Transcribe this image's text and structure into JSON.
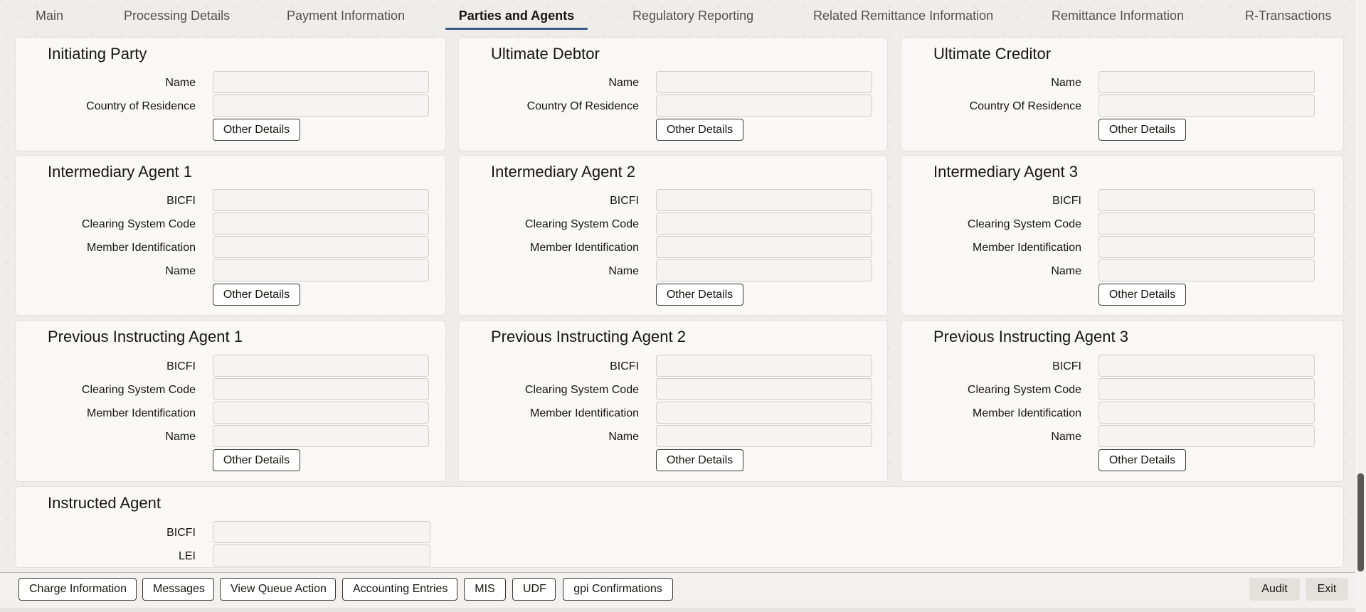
{
  "tabs": [
    {
      "label": "Main"
    },
    {
      "label": "Processing Details"
    },
    {
      "label": "Payment Information"
    },
    {
      "label": "Parties and Agents"
    },
    {
      "label": "Regulatory Reporting"
    },
    {
      "label": "Related Remittance Information"
    },
    {
      "label": "Remittance Information"
    },
    {
      "label": "R-Transactions"
    }
  ],
  "active_tab": "Parties and Agents",
  "accent_color": "#3d5c85",
  "panels": {
    "initiating_party": {
      "title": "Initiating Party",
      "name_label": "Name",
      "country_label": "Country of Residence",
      "other_details": "Other Details"
    },
    "ultimate_debtor": {
      "title": "Ultimate Debtor",
      "name_label": "Name",
      "country_label": "Country Of Residence",
      "other_details": "Other Details"
    },
    "ultimate_creditor": {
      "title": "Ultimate Creditor",
      "name_label": "Name",
      "country_label": "Country Of Residence",
      "other_details": "Other Details"
    },
    "intermediary_agent_1": {
      "title": "Intermediary Agent 1",
      "bicfi_label": "BICFI",
      "clearing_label": "Clearing System Code",
      "member_label": "Member Identification",
      "name_label": "Name",
      "other_details": "Other Details"
    },
    "intermediary_agent_2": {
      "title": "Intermediary Agent 2",
      "bicfi_label": "BICFI",
      "clearing_label": "Clearing System Code",
      "member_label": "Member Identification",
      "name_label": "Name",
      "other_details": "Other Details"
    },
    "intermediary_agent_3": {
      "title": "Intermediary Agent 3",
      "bicfi_label": "BICFI",
      "clearing_label": "Clearing System Code",
      "member_label": "Member Identification",
      "name_label": "Name",
      "other_details": "Other Details"
    },
    "previous_instructing_agent_1": {
      "title": "Previous Instructing Agent 1",
      "bicfi_label": "BICFI",
      "clearing_label": "Clearing System Code",
      "member_label": "Member Identification",
      "name_label": "Name",
      "other_details": "Other Details"
    },
    "previous_instructing_agent_2": {
      "title": "Previous Instructing Agent 2",
      "bicfi_label": "BICFI",
      "clearing_label": "Clearing System Code",
      "member_label": "Member Identification",
      "name_label": "Name",
      "other_details": "Other Details"
    },
    "previous_instructing_agent_3": {
      "title": "Previous Instructing Agent 3",
      "bicfi_label": "BICFI",
      "clearing_label": "Clearing System Code",
      "member_label": "Member Identification",
      "name_label": "Name",
      "other_details": "Other Details"
    },
    "instructed_agent": {
      "title": "Instructed Agent",
      "bicfi_label": "BICFI",
      "lei_label": "LEI"
    }
  },
  "footer": {
    "charge_information": "Charge Information",
    "messages": "Messages",
    "view_queue_action": "View Queue Action",
    "accounting_entries": "Accounting Entries",
    "mis": "MIS",
    "udf": "UDF",
    "gpi_confirmations": "gpi Confirmations",
    "audit": "Audit",
    "exit": "Exit"
  }
}
